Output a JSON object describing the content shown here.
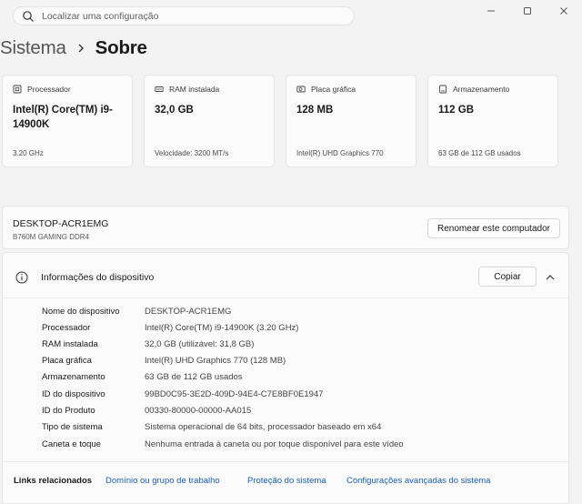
{
  "search": {
    "placeholder": "Localizar uma configuração"
  },
  "header": {
    "breadcrumb_parent": "Sistema",
    "breadcrumb_current": "Sobre"
  },
  "cards": [
    {
      "label": "Processador",
      "value": "Intel(R) Core(TM) i9-14900K",
      "sub": "3.20 GHz",
      "icon": "processor-icon"
    },
    {
      "label": "RAM instalada",
      "value": "32,0 GB",
      "sub": "Velocidade: 3200 MT/s",
      "icon": "ram-icon"
    },
    {
      "label": "Placa gráfica",
      "value": "128 MB",
      "sub": "Intel(R) UHD Graphics 770",
      "icon": "gpu-icon"
    },
    {
      "label": "Armazenamento",
      "value": "112 GB",
      "sub": "63 GB de 112 GB usados",
      "icon": "storage-icon"
    }
  ],
  "device": {
    "name": "DESKTOP-ACR1EMG",
    "model": "B760M GAMING DDR4",
    "rename_label": "Renomear este computador"
  },
  "info": {
    "title": "Informações do dispositivo",
    "copy_label": "Copiar",
    "specs": [
      {
        "label": "Nome do dispositivo",
        "value": "DESKTOP-ACR1EMG"
      },
      {
        "label": "Processador",
        "value": "Intel(R) Core(TM) i9-14900K (3.20 GHz)"
      },
      {
        "label": "RAM instalada",
        "value": "32,0 GB (utilizável: 31,8 GB)"
      },
      {
        "label": "Placa gráfica",
        "value": "Intel(R) UHD Graphics 770 (128 MB)"
      },
      {
        "label": "Armazenamento",
        "value": "63 GB de 112 GB usados"
      },
      {
        "label": "ID do dispositivo",
        "value": "99BD0C95-3E2D-409D-94E4-C7E8BF0E1947"
      },
      {
        "label": "ID do Produto",
        "value": "00330-80000-00000-AA015"
      },
      {
        "label": "Tipo de sistema",
        "value": "Sistema operacional de 64 bits, processador baseado em x64"
      },
      {
        "label": "Caneta e toque",
        "value": "Nenhuma entrada à caneta ou por toque disponível para este vídeo"
      }
    ]
  },
  "related": {
    "label": "Links relacionados",
    "links": [
      "Domínio ou grupo de trabalho",
      "Proteção do sistema",
      "Configurações avançadas do sistema"
    ]
  },
  "colors": {
    "accent": "#1a5fb4",
    "background": "#f3f3f3",
    "card": "#fbfbfb"
  }
}
